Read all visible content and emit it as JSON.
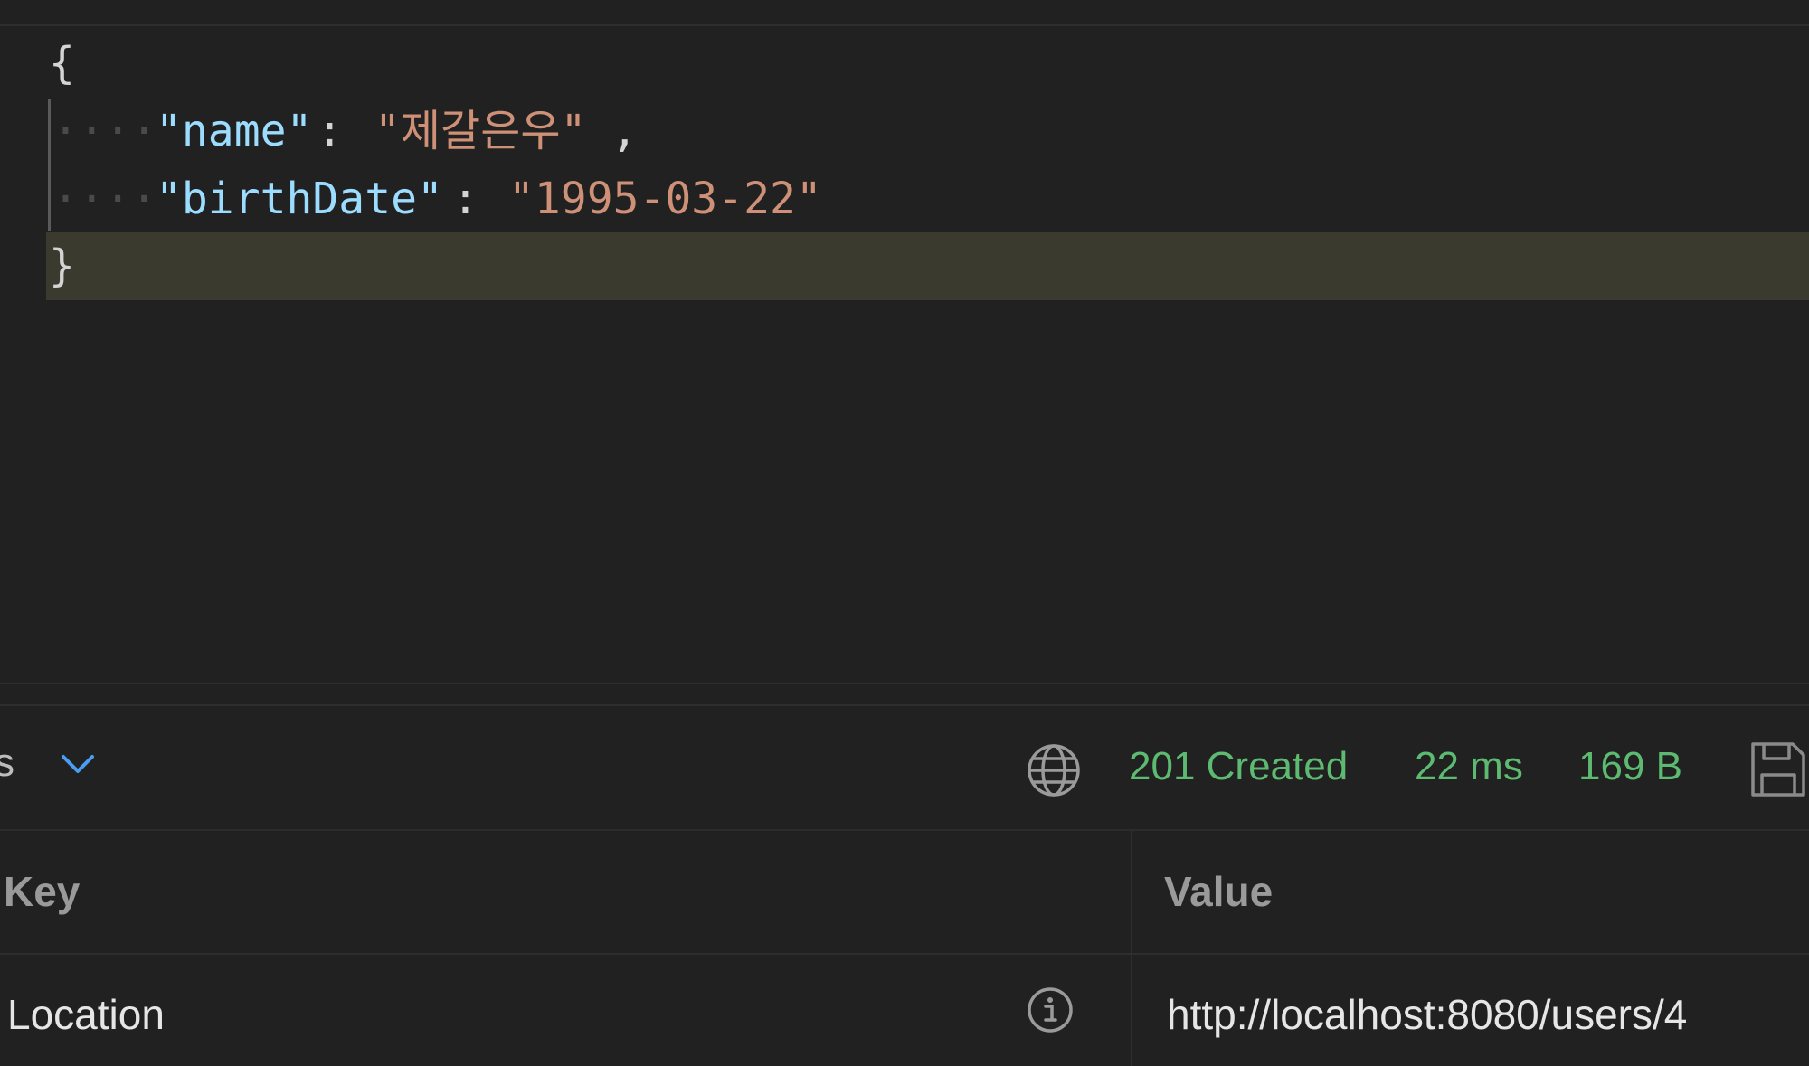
{
  "editor": {
    "lines": [
      {
        "open_brace": "{"
      },
      {
        "key": "\"name\"",
        "colon": ":",
        "value": "\"제갈은우\"",
        "comma": ","
      },
      {
        "key": "\"birthDate\"",
        "colon": ":",
        "value": "\"1995-03-22\""
      },
      {
        "close_brace": "}"
      }
    ],
    "whitespace_marker": "····"
  },
  "response_toolbar": {
    "tab_fragment": "s",
    "status_code": "201 Created",
    "time": "22 ms",
    "size": "169 B",
    "status_color": "#5dbb71",
    "icons": [
      "chevron-down-icon",
      "globe-icon",
      "save-icon"
    ]
  },
  "headers_table": {
    "columns": [
      "Key",
      "Value"
    ],
    "rows": [
      {
        "key": "Location",
        "value": "http://localhost:8080/users/4",
        "icon": "info-icon"
      }
    ]
  },
  "colors": {
    "background": "#212121",
    "json_key": "#9cdcfe",
    "json_string": "#ce9178",
    "current_line": "#3a3a2f"
  }
}
